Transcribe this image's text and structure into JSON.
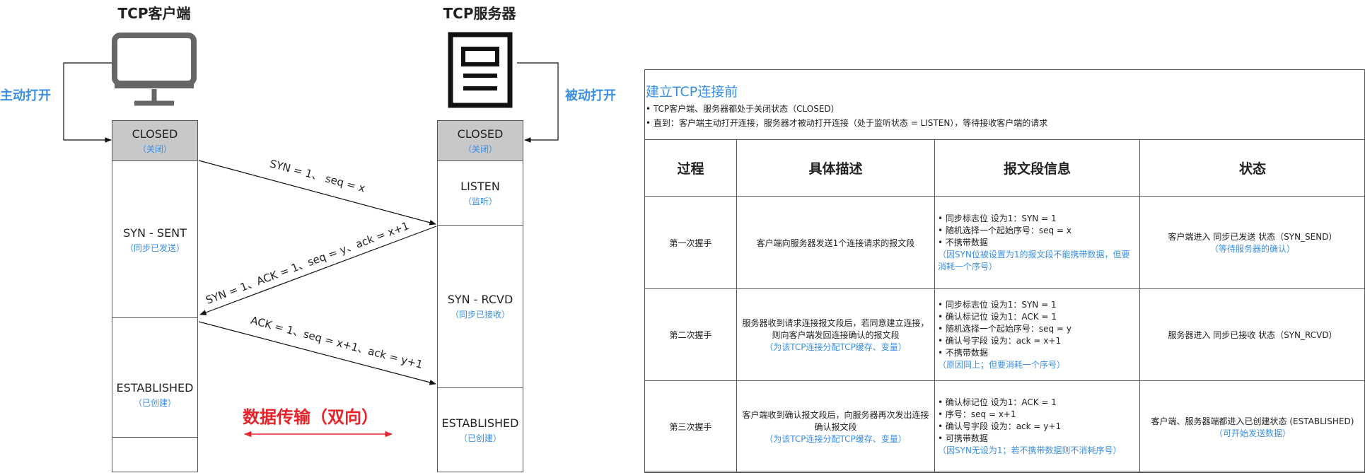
{
  "client": {
    "title": "TCP客户端",
    "open_label": "主动打开"
  },
  "server": {
    "title": "TCP服务器",
    "open_label": "被动打开"
  },
  "client_states": [
    {
      "name": "CLOSED",
      "note": "（关闭）"
    },
    {
      "name": "SYN - SENT",
      "note": "（同步已发送）"
    },
    {
      "name": "ESTABLISHED",
      "note": "（已创建）"
    }
  ],
  "server_states": [
    {
      "name": "CLOSED",
      "note": "（关闭）"
    },
    {
      "name": "LISTEN",
      "note": "（监听）"
    },
    {
      "name": "SYN - RCVD",
      "note": "（同步已接收）"
    },
    {
      "name": "ESTABLISHED",
      "note": "（已创建）"
    }
  ],
  "messages": [
    "SYN = 1、 seq = x",
    "SYN = 1、ACK = 1、seq = y、ack = x+1",
    "ACK = 1、seq = x+1、ack = y+1"
  ],
  "data_transfer": "数据传输（双向）",
  "before": {
    "title": "建立TCP连接前",
    "lines": [
      "• TCP客户端、服务器都处于关闭状态（CLOSED）",
      "• 直到：客户端主动打开连接，服务器才被动打开连接（处于监听状态 = LISTEN），等待接收客户端的请求"
    ]
  },
  "table": {
    "headers": [
      "过程",
      "具体描述",
      "报文段信息",
      "状态"
    ],
    "rows": [
      {
        "step": "第一次握手",
        "desc": "客户端向服务器发送1个连接请求的报文段",
        "desc_note": "",
        "info": [
          "• 同步标志位 设为1：SYN = 1",
          "• 随机选择一个起始序号：seq = x",
          "• 不携带数据"
        ],
        "info_note": "（因SYN位被设置为1的报文段不能携带数据，但要消耗一个序号）",
        "state": "客户端进入 同步已发送 状态（SYN_SEND）",
        "state_note": "（等待服务器的确认）"
      },
      {
        "step": "第二次握手",
        "desc": "服务器收到请求连接报文段后，若同意建立连接，则向客户端发回连接确认的报文段",
        "desc_note": "（为该TCP连接分配TCP缓存、变量）",
        "info": [
          "• 同步标志位 设为1：SYN = 1",
          "• 确认标记位 设为1：ACK = 1",
          "• 随机选择一个起始序号：seq = y",
          "• 确认号字段 设为：ack = x+1",
          "• 不携带数据"
        ],
        "info_note": "（原因同上；但要消耗一个序号）",
        "state": "服务器进入 同步已接收 状态（SYN_RCVD）",
        "state_note": ""
      },
      {
        "step": "第三次握手",
        "desc": "客户端收到确认报文段后，向服务器再次发出连接确认报文段",
        "desc_note": "（为该TCP连接分配TCP缓存、变量）",
        "info": [
          "• 确认标记位 设为1：ACK = 1",
          "• 序号：seq = x+1",
          "• 确认号字段 设为：ack = y+1",
          "• 可携带数据"
        ],
        "info_note": "（因SYN无设为1；若不携带数据则不消耗序号）",
        "state": "客户端、服务器端都进入已创建状态 (ESTABLISHED)",
        "state_note": "（可开始发送数据）"
      }
    ]
  },
  "colors": {
    "accent_blue": "#3a8ee6",
    "data_red": "#e8232a",
    "closed_gray": "#c8c8c8"
  },
  "icons": {
    "client": "monitor-icon",
    "server": "server-document-icon"
  }
}
